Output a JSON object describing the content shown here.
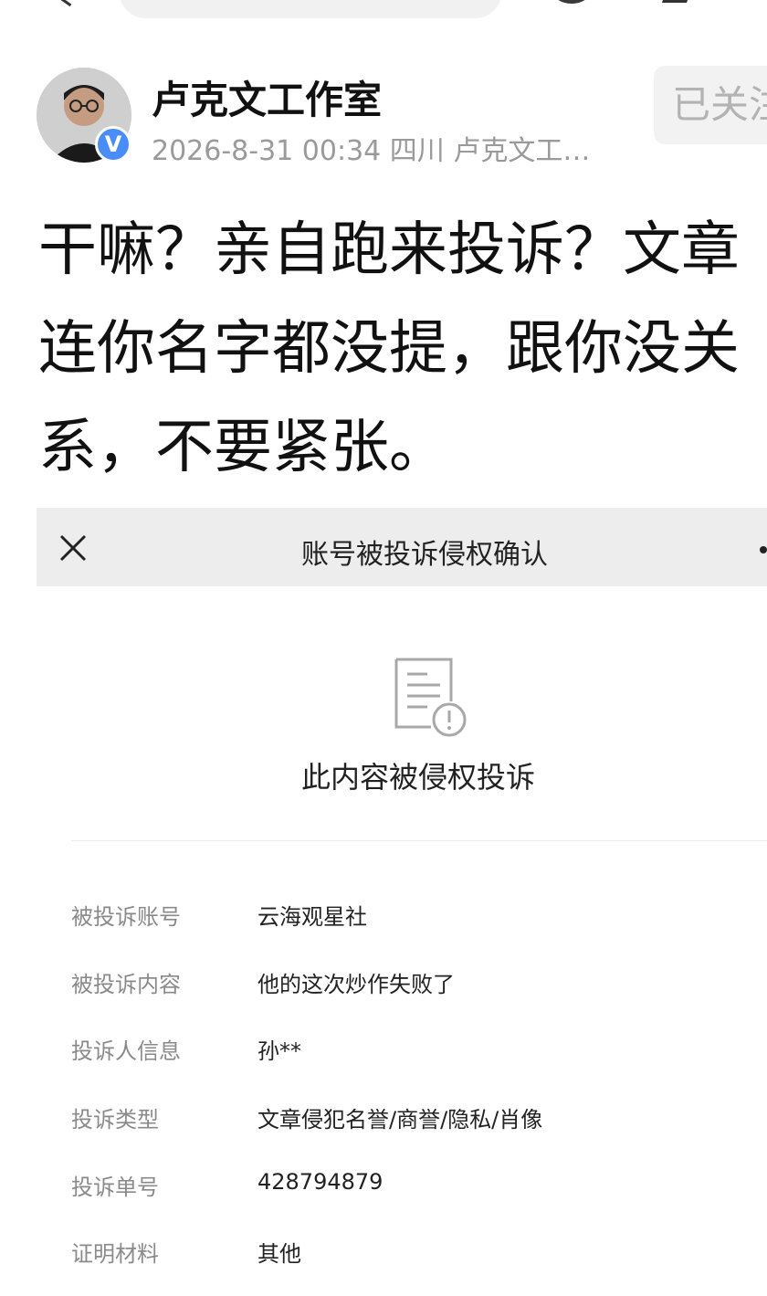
{
  "post": {
    "author": "卢克文工作室",
    "meta": "2026-8-31 00:34 四川 卢克文工…",
    "verified_badge": "V",
    "follow_label": "已关注",
    "text_lines": [
      "干嘛？亲自跑来投诉？文章",
      "连你名字都没提，跟你没关",
      "系，不要紧张。"
    ]
  },
  "complaint": {
    "bar_title": "账号被投诉侵权确认",
    "heading": "此内容被侵权投诉",
    "rows": [
      {
        "label": "被投诉账号",
        "value": "云海观星社"
      },
      {
        "label": "被投诉内容",
        "value": "他的这次炒作失败了"
      },
      {
        "label": "投诉人信息",
        "value": "孙**"
      },
      {
        "label": "投诉类型",
        "value": "文章侵犯名誉/商誉/隐私/肖像"
      },
      {
        "label": "投诉单号",
        "value": "428794879"
      },
      {
        "label": "证明材料",
        "value": "其他"
      }
    ]
  },
  "colors": {
    "verified_badge": "#4a8df8",
    "bar_background": "#ededed",
    "muted_text": "#9a9a9a"
  },
  "icons": [
    "back-icon",
    "search-bar",
    "avatar",
    "close-icon",
    "more-icon",
    "document-warning-icon"
  ]
}
